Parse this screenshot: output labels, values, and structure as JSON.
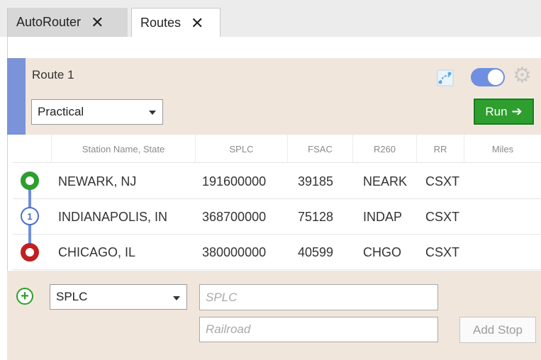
{
  "tabs": [
    {
      "label": "AutoRouter",
      "close": "✕"
    },
    {
      "label": "Routes",
      "close": "✕"
    }
  ],
  "route": {
    "title": "Route 1",
    "mode": "Practical",
    "run_label": "Run",
    "run_arrow": "➔",
    "toggle_on": true
  },
  "table": {
    "headers": [
      "Station Name, State",
      "SPLC",
      "FSAC",
      "R260",
      "RR",
      "Miles"
    ],
    "rows": [
      {
        "station": "NEWARK, NJ",
        "splc": "191600000",
        "fsac": "39185",
        "r260": "NEARK",
        "rr": "CSXT",
        "miles": ""
      },
      {
        "station": "INDIANAPOLIS, IN",
        "splc": "368700000",
        "fsac": "75128",
        "r260": "INDAP",
        "rr": "CSXT",
        "miles": ""
      },
      {
        "station": "CHICAGO, IL",
        "splc": "380000000",
        "fsac": "40599",
        "r260": "CHGO",
        "rr": "CSXT",
        "miles": ""
      }
    ],
    "mid_stop_number": "1"
  },
  "add_stop": {
    "plus": "+",
    "type": "SPLC",
    "splc_placeholder": "SPLC",
    "railroad_placeholder": "Railroad",
    "button_label": "Add Stop"
  },
  "colors": {
    "accent": "#7a93d9",
    "run_green": "#2e9e2e",
    "start_marker": "#2e9e2e",
    "end_marker": "#c02020",
    "header_bg": "#f1e6dc"
  }
}
